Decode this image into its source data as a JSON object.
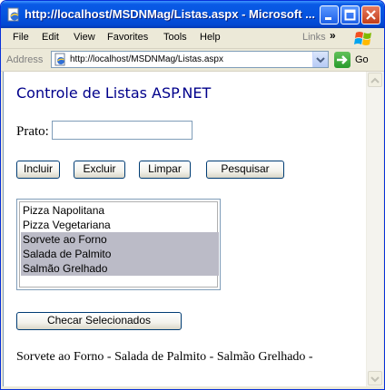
{
  "window": {
    "title": "http://localhost/MSDNMag/Listas.aspx - Microsoft ..."
  },
  "menu": {
    "items": [
      "File",
      "Edit",
      "View",
      "Favorites",
      "Tools",
      "Help"
    ],
    "links_label": "Links",
    "chevron": "»"
  },
  "address_bar": {
    "label": "Address",
    "url": "http://localhost/MSDNMag/Listas.aspx",
    "go_label": "Go"
  },
  "page": {
    "title": "Controle de Listas ASP.NET",
    "prato_label": "Prato:",
    "prato_value": "",
    "buttons": {
      "incluir": "Incluir",
      "excluir": "Excluir",
      "limpar": "Limpar",
      "pesquisar": "Pesquisar",
      "checar": "Checar Selecionados"
    },
    "list_items": [
      {
        "label": "Pizza Napolitana",
        "selected": false
      },
      {
        "label": "Pizza Vegetariana",
        "selected": false
      },
      {
        "label": "Sorvete ao Forno",
        "selected": true
      },
      {
        "label": "Salada de Palmito",
        "selected": true
      },
      {
        "label": "Salmão Grelhado",
        "selected": true
      }
    ],
    "result_text": "Sorvete ao Forno - Salada de Palmito - Salmão Grelhado -"
  },
  "colors": {
    "title_text": "#00008b",
    "selection": "#bbbbc7",
    "titlebar": "#0555e0"
  }
}
